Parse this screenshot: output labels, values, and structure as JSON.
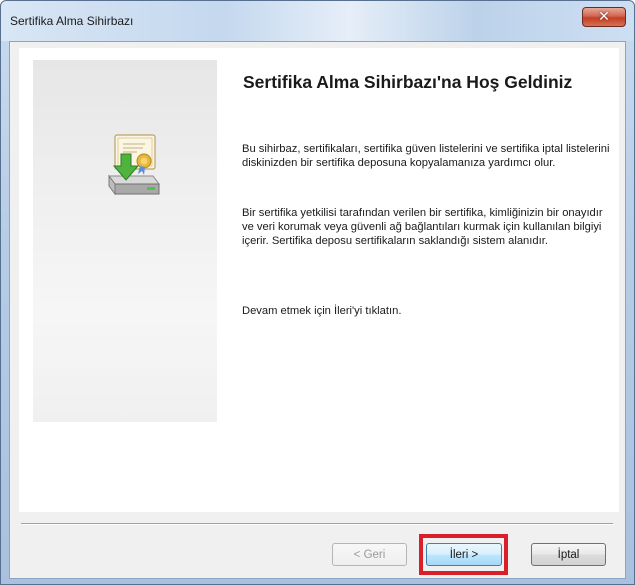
{
  "window": {
    "title": "Sertifika Alma Sihirbazı",
    "close_glyph": "✕"
  },
  "wizard": {
    "icon": "certificate-import-icon",
    "heading": "Sertifika Alma Sihirbazı'na Hoş Geldiniz",
    "paragraph1": "Bu sihirbaz, sertifikaları, sertifika güven listelerini ve sertifika iptal listelerini diskinizden bir sertifika deposuna kopyalamanıza yardımcı olur.",
    "paragraph2": "Bir sertifika yetkilisi tarafından verilen bir sertifika, kimliğinizin bir onayıdır ve veri korumak veya güvenli ağ bağlantıları kurmak için kullanılan bilgiyi içerir. Sertifika deposu sertifikaların saklandığı sistem alanıdır.",
    "paragraph3": "Devam etmek için İleri'yi tıklatın."
  },
  "buttons": {
    "back": "< Geri",
    "next": "İleri >",
    "cancel": "İptal"
  },
  "colors": {
    "highlight": "#d81f2a",
    "close_button": "#c23f26"
  }
}
